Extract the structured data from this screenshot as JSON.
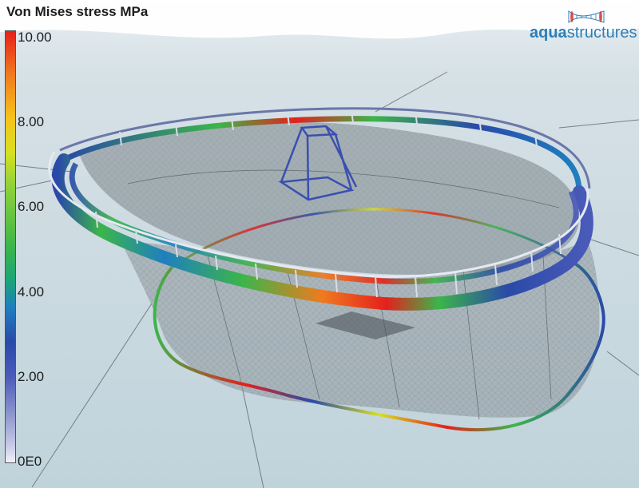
{
  "legend": {
    "title": "Von Mises stress MPa",
    "ticks": [
      "10.00",
      "8.00",
      "6.00",
      "4.00",
      "2.00",
      "0E0"
    ]
  },
  "brand": {
    "part1": "aqua",
    "part2": "structures"
  },
  "icons": {
    "brand_logo": "tube-mesh-logo"
  },
  "colors": {
    "stress_high": "#e5201c",
    "stress_mid": "#3cb54a",
    "stress_low": "#2a4aa8",
    "brand": "#2c7fb8",
    "water": "#c9d8df",
    "net": "#7f8a90"
  }
}
